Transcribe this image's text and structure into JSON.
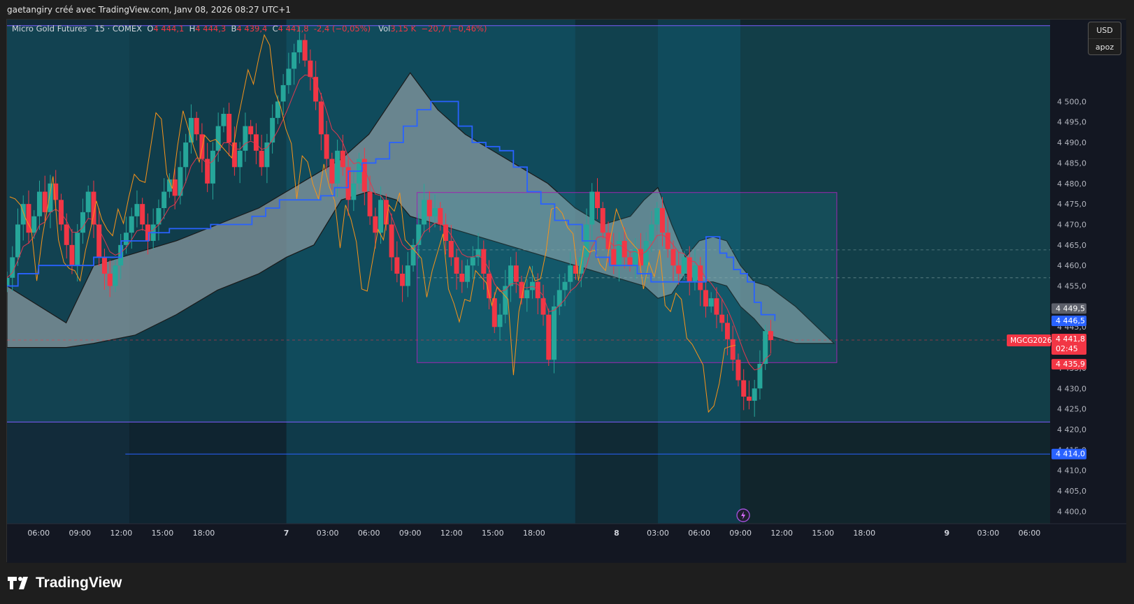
{
  "header": {
    "credit": "gaetangiry créé avec TradingView.com, Janv 08, 2026 08:27 UTC+1"
  },
  "legend": {
    "symbol": "Micro Gold Futures · 15 · COMEX",
    "o_label": "O",
    "o_value": "4 444,1",
    "h_label": "H",
    "h_value": "4 444,3",
    "b_label": "B",
    "b_value": "4 439,4",
    "c_label": "C",
    "c_value": "4 441,8",
    "change": "-2,4 (−0,05%)",
    "vol_label": "Vol",
    "vol_value": "3,15 K",
    "vol_change": "−20,7 (−0,46%)"
  },
  "scale_box": {
    "currency": "USD",
    "mode": "apoz"
  },
  "brand": {
    "name": "TradingView"
  },
  "colors": {
    "up": "#26a69a",
    "down": "#f23645",
    "blue_line": "#2962ff",
    "orange_line": "#f7931a",
    "cloud": "#9aa5ab",
    "box_border": "#9c27b0",
    "level_line": "#7b5cff",
    "background": "#131722"
  },
  "price_badges": [
    {
      "label": "4 449,5",
      "color": "#5d606b"
    },
    {
      "label": "4 446,5",
      "color": "#2962ff"
    },
    {
      "label": "4 441,8",
      "sub": "02:45",
      "tag": "MGCG2026",
      "color": "#f23645"
    },
    {
      "label": "4 435,9",
      "color": "#f23645"
    },
    {
      "label": "4 414,0",
      "color": "#2962ff"
    }
  ],
  "chart_data": {
    "type": "candlestick",
    "title": "Micro Gold Futures · 15 · COMEX",
    "ylim": [
      4397,
      4520
    ],
    "y_ticks": [
      "4 500,0",
      "4 495,0",
      "4 490,0",
      "4 485,0",
      "4 480,0",
      "4 475,0",
      "4 470,0",
      "4 465,0",
      "4 460,0",
      "4 455,0",
      "4 450,0",
      "4 445,0",
      "4 440,0",
      "4 435,0",
      "4 430,0",
      "4 425,0",
      "4 420,0",
      "4 415,0",
      "4 410,0",
      "4 405,0",
      "4 400,0"
    ],
    "y_tick_values": [
      4500,
      4495,
      4490,
      4485,
      4480,
      4475,
      4470,
      4465,
      4460,
      4455,
      4450,
      4445,
      4440,
      4435,
      4430,
      4425,
      4420,
      4415,
      4410,
      4405,
      4400
    ],
    "x_ticks": [
      "06:00",
      "09:00",
      "12:00",
      "15:00",
      "18:00",
      "7",
      "03:00",
      "06:00",
      "09:00",
      "12:00",
      "15:00",
      "18:00",
      "8",
      "03:00",
      "06:00",
      "09:00",
      "12:00",
      "15:00",
      "18:00",
      "9",
      "03:00",
      "06:00"
    ],
    "x_tick_hours": [
      6,
      9,
      12,
      15,
      18,
      24,
      27,
      30,
      33,
      36,
      39,
      42,
      48,
      51,
      54,
      57,
      60,
      63,
      66,
      72,
      75,
      78
    ],
    "x_start_hour": 3.7,
    "x_end_hour": 79.5,
    "horizontal_levels": [
      4518.5,
      4421.8,
      4414.0
    ],
    "range_box": {
      "from_hour": 33.5,
      "to_hour": 64.0,
      "top": 4477.8,
      "bottom": 4436.3
    },
    "dashed_levels": [
      4463.8,
      4457.0,
      4441.8
    ],
    "series": [
      {
        "name": "Price",
        "type": "candlestick"
      },
      {
        "name": "Kijun",
        "type": "line"
      },
      {
        "name": "Orange",
        "type": "line"
      },
      {
        "name": "Red",
        "type": "line"
      },
      {
        "name": "Cloud",
        "type": "area"
      }
    ],
    "closes": [
      4457,
      4462,
      4470,
      4475,
      4468,
      4472,
      4478,
      4473,
      4480,
      4476,
      4470,
      4465,
      4460,
      4468,
      4473,
      4478,
      4470,
      4462,
      4458,
      4455,
      4460,
      4465,
      4468,
      4472,
      4475,
      4470,
      4466,
      4470,
      4474,
      4478,
      4481,
      4477,
      4484,
      4490,
      4496,
      4492,
      4486,
      4480,
      4488,
      4494,
      4497,
      4490,
      4484,
      4488,
      4494,
      4492,
      4488,
      4484,
      4490,
      4496,
      4500,
      4504,
      4508,
      4512,
      4515,
      4510,
      4506,
      4500,
      4492,
      4486,
      4480,
      4488,
      4484,
      4476,
      4480,
      4486,
      4478,
      4472,
      4468,
      4476,
      4470,
      4462,
      4458,
      4455,
      4460,
      4465,
      4470,
      4476,
      4472,
      4474,
      4470,
      4466,
      4462,
      4458,
      4456,
      4460,
      4462,
      4464,
      4458,
      4452,
      4445,
      4448,
      4455,
      4460,
      4456,
      4452,
      4454,
      4456,
      4452,
      4448,
      4437,
      4450,
      4454,
      4456,
      4460,
      4458,
      4462,
      4470,
      4478,
      4474,
      4468,
      4464,
      4460,
      4466,
      4462,
      4460,
      4464,
      4460,
      4466,
      4470,
      4474,
      4468,
      4464,
      4460,
      4458,
      4462,
      4456,
      4460,
      4454,
      4450,
      4452,
      4448,
      4446,
      4442,
      4437,
      4432,
      4428,
      4427,
      4430,
      4436,
      4444,
      4441.8
    ],
    "kijun": [
      4455,
      4458,
      4460,
      4460,
      4462,
      4466,
      4468,
      4469,
      4469,
      4470,
      4470,
      4472,
      4474,
      4476,
      4476,
      4476,
      4477,
      4479,
      4483,
      4485,
      4486,
      4490,
      4494,
      4498,
      4500,
      4500,
      4494,
      4490,
      4489,
      4488,
      4484,
      4478,
      4475,
      4471,
      4470,
      4466,
      4462,
      4460,
      4460,
      4458,
      4456,
      4456,
      4456,
      4456,
      4456,
      4456,
      4467,
      4467,
      4463,
      4462,
      4459,
      4458,
      4456,
      4451,
      4448,
      4448,
      4446.5
    ],
    "kijun_hours": [
      3.7,
      4.5,
      6,
      8,
      10,
      12,
      14,
      15.5,
      17,
      18.5,
      20,
      21.5,
      22.5,
      23.5,
      24.5,
      25.5,
      26.5,
      27.5,
      28.5,
      29.5,
      30.5,
      31.5,
      32.5,
      33.5,
      34.5,
      35.5,
      36.5,
      37.5,
      38.5,
      39.5,
      40.5,
      41.5,
      42.5,
      43.5,
      44.5,
      45.5,
      46.5,
      47.5,
      48.5,
      49.5,
      50.5,
      51.5,
      52.5,
      53.0,
      53.5,
      54.0,
      54.5,
      55.0,
      55.5,
      56.0,
      56.5,
      57.0,
      57.5,
      58.0,
      58.5,
      59.0,
      59.5
    ],
    "cloud_top": [
      4455,
      4446,
      4460,
      4463,
      4466,
      4470,
      4474,
      4478,
      4482,
      4486,
      4492,
      4502,
      4507,
      4498,
      4492,
      4488,
      4484,
      4480,
      4474,
      4470,
      4472,
      4476,
      4479,
      4470,
      4462,
      4466,
      4467,
      4466,
      4460,
      4456,
      4455,
      4450,
      4441
    ],
    "cloud_bottom": [
      4440,
      4440,
      4441,
      4443,
      4448,
      4454,
      4458,
      4462,
      4465,
      4476,
      4478,
      4476,
      4472,
      4470,
      4468,
      4466,
      4464,
      4462,
      4460,
      4458,
      4456,
      4455,
      4452,
      4453,
      4458,
      4456,
      4456,
      4455,
      4450,
      4447,
      4443,
      4441,
      4441
    ],
    "cloud_hours": [
      3.7,
      8,
      10,
      13,
      16,
      19,
      22,
      24,
      26,
      28,
      30,
      32,
      33,
      35,
      37,
      39,
      41,
      43,
      45,
      47,
      49,
      50,
      51,
      52,
      53,
      54,
      55,
      56,
      57,
      58,
      59,
      61,
      63.8
    ]
  }
}
